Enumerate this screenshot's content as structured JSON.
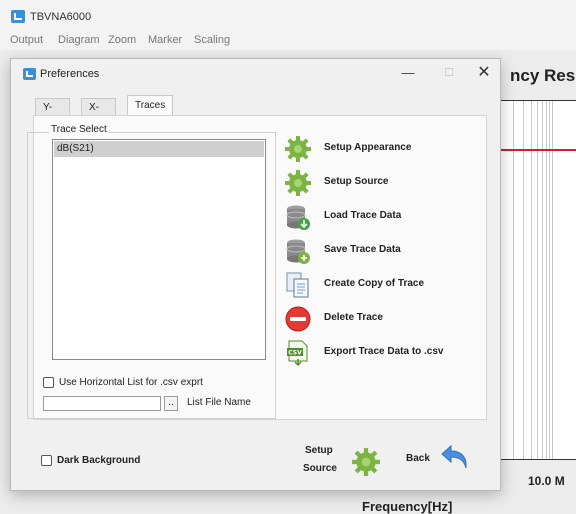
{
  "app": {
    "title": "TBVNA6000"
  },
  "menu": [
    "Output",
    "Diagram",
    "Zoom",
    "Marker",
    "Scaling"
  ],
  "plot": {
    "heading": "ncy Resp",
    "tick_label": "10.0 M",
    "x_axis_label": "Frequency[Hz]"
  },
  "dialog": {
    "title": "Preferences",
    "min_glyph": "—",
    "max_glyph": "☐",
    "close_glyph": "✕",
    "tabs": [
      {
        "label": "Y-Axis"
      },
      {
        "label": "X-Axis"
      },
      {
        "label": "Traces"
      }
    ],
    "trace_select": {
      "label": "Trace Select",
      "items": [
        "dB(S21)"
      ]
    },
    "actions": [
      {
        "label": "Setup Appearance",
        "icon": "gear-icon"
      },
      {
        "label": "Setup Source",
        "icon": "gear-icon"
      },
      {
        "label": "Load Trace Data",
        "icon": "database-load-icon"
      },
      {
        "label": "Save Trace Data",
        "icon": "database-save-icon"
      },
      {
        "label": "Create Copy of Trace",
        "icon": "copy-document-icon"
      },
      {
        "label": "Delete Trace",
        "icon": "delete-icon"
      },
      {
        "label": "Export Trace Data to .csv",
        "icon": "csv-export-icon"
      }
    ],
    "horizontal_list_checkbox": {
      "label": "Use Horizontal List for .csv exprt",
      "checked": false
    },
    "list_file": {
      "value": "",
      "browse_label": "..",
      "label": "List File Name"
    },
    "dark_background": {
      "label": "Dark Background",
      "checked": false
    },
    "setup_source_button": {
      "line1": "Setup",
      "line2": "Source"
    },
    "back_button": {
      "label": "Back"
    }
  },
  "colors": {
    "gear": "#7cb342",
    "trace": "#d02020",
    "delete": "#e53935",
    "back_arrow": "#4a90e2",
    "app_accent": "#3a8fd6"
  }
}
